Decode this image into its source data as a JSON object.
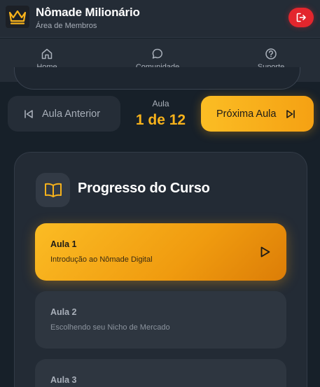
{
  "header": {
    "title": "Nômade Milionário",
    "subtitle": "Área de Membros",
    "logo_icon": "crown-icon",
    "logout_icon": "logout-icon",
    "accent": "#f7b21b",
    "danger": "#e3262d"
  },
  "nav": {
    "items": [
      {
        "label": "Home",
        "icon": "home-icon"
      },
      {
        "label": "Comunidade",
        "icon": "chat-bubble-icon"
      },
      {
        "label": "Suporte",
        "icon": "help-circle-icon"
      }
    ]
  },
  "lesson_nav": {
    "prev_label": "Aula Anterior",
    "prev_icon": "skip-back-icon",
    "caption": "Aula",
    "counter": "1 de 12",
    "next_label": "Próxima Aula",
    "next_icon": "skip-forward-icon"
  },
  "progress": {
    "title": "Progresso do Curso",
    "icon": "book-open-icon",
    "lessons": [
      {
        "title": "Aula 1",
        "subtitle": "Introdução ao Nômade Digital",
        "active": true
      },
      {
        "title": "Aula 2",
        "subtitle": "Escolhendo seu Nicho de Mercado",
        "active": false
      },
      {
        "title": "Aula 3",
        "subtitle": "",
        "active": false
      }
    ]
  }
}
